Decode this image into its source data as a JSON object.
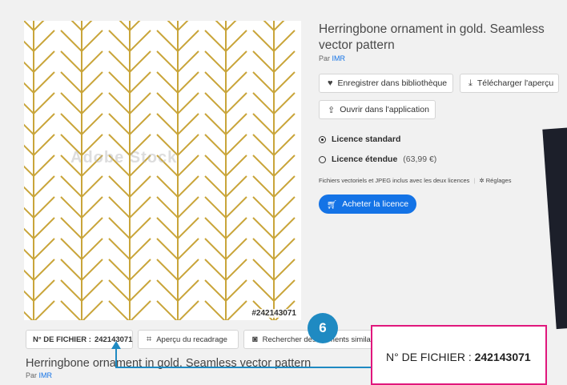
{
  "image": {
    "file_number_overlay": "#242143071",
    "watermark": "Adobe Stock",
    "pattern_color": "#c9a53a"
  },
  "detail": {
    "title": "Herringbone ornament in gold. Seamless vector pattern",
    "by_label": "Par",
    "author": "IMR",
    "save_label": "Enregistrer dans bibliothèque",
    "download_label": "Télécharger l'aperçu",
    "open_label": "Ouvrir dans l'application",
    "license_standard": "Licence standard",
    "license_extended": "Licence étendue",
    "license_extended_price": "(63,99 €)",
    "files_note": "Fichiers vectoriels et JPEG inclus avec les deux licences",
    "settings_label": "Réglages",
    "buy_label": "Acheter la licence"
  },
  "bottom_bar": {
    "file_no_label": "N° DE FICHIER :",
    "file_no": "242143071",
    "crop_label": "Aperçu du recadrage",
    "similar_label": "Rechercher des éléments similaires"
  },
  "below": {
    "title": "Herringbone ornament in gold. Seamless vector pattern",
    "by_label": "Par",
    "author": "IMR"
  },
  "callout": {
    "badge": "6",
    "label": "N° DE FICHIER :",
    "value": "242143071",
    "box_color": "#e0177c",
    "arrow_color": "#1f8ac2"
  }
}
